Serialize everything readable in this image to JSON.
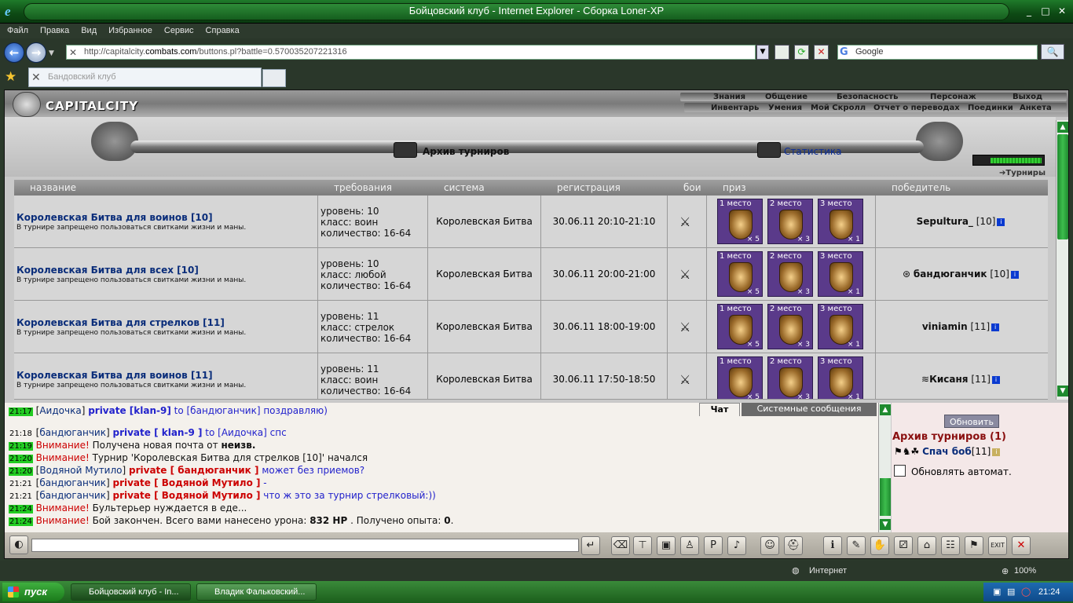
{
  "window": {
    "title": "Бойцовский клуб - Internet Explorer - Сборка Loner-XP",
    "controls": [
      "_",
      "□",
      "✕"
    ]
  },
  "menu": [
    "Файл",
    "Правка",
    "Вид",
    "Избранное",
    "Сервис",
    "Справка"
  ],
  "address": {
    "prefix": "http://capitalcity.",
    "domain": "combats.com",
    "suffix": "/buttons.pl?battle=0.570035207221316"
  },
  "search": {
    "placeholder": "Google"
  },
  "tab": {
    "label": "Бандовский клуб"
  },
  "site": {
    "logo": "CAPITALCITY",
    "nav_top": [
      "Знания",
      "Общение",
      "Безопасность",
      "Персонаж",
      "Выход"
    ],
    "nav_bottom": [
      "Инвентарь",
      "Умения",
      "Мой Скролл",
      "Отчет о переводах",
      "Поединки",
      "Анкета"
    ]
  },
  "banner": {
    "archive": "Архив турниров",
    "stats": "Статистика",
    "tournaments_link": "Турниры"
  },
  "table": {
    "headers": [
      "название",
      "требования",
      "система",
      "регистрация",
      "бои",
      "приз",
      "победитель"
    ],
    "rows": [
      {
        "name": "Королевская Битва для воинов [10]",
        "desc": "В турнире запрещено пользоваться свитками жизни и маны.",
        "req": [
          "уровень: 10",
          "класс: воин",
          "количество: 16-64"
        ],
        "system": "Королевская Битва",
        "reg": "30.06.11 20:10-21:10",
        "prizes": [
          {
            "place": "1 место",
            "count": "× 5"
          },
          {
            "place": "2 место",
            "count": "× 3"
          },
          {
            "place": "3 место",
            "count": "× 1"
          }
        ],
        "winner": "Sepultura_",
        "winner_lvl": "[10]"
      },
      {
        "name": "Королевская Битва для всех [10]",
        "desc": "В турнире запрещено пользоваться свитками жизни и маны.",
        "req": [
          "уровень: 10",
          "класс: любой",
          "количество: 16-64"
        ],
        "system": "Королевская Битва",
        "reg": "30.06.11 20:00-21:00",
        "prizes": [
          {
            "place": "1 место",
            "count": "× 5"
          },
          {
            "place": "2 место",
            "count": "× 3"
          },
          {
            "place": "3 место",
            "count": "× 1"
          }
        ],
        "winner": "бандюганчик",
        "winner_lvl": "[10]"
      },
      {
        "name": "Королевская Битва для стрелков [11]",
        "desc": "В турнире запрещено пользоваться свитками жизни и маны.",
        "req": [
          "уровень: 11",
          "класс: стрелок",
          "количество: 16-64"
        ],
        "system": "Королевская Битва",
        "reg": "30.06.11 18:00-19:00",
        "prizes": [
          {
            "place": "1 место",
            "count": "× 5"
          },
          {
            "place": "2 место",
            "count": "× 3"
          },
          {
            "place": "3 место",
            "count": "× 1"
          }
        ],
        "winner": "viniamin",
        "winner_lvl": "[11]"
      },
      {
        "name": "Королевская Битва для воинов [11]",
        "desc": "В турнире запрещено пользоваться свитками жизни и маны.",
        "req": [
          "уровень: 11",
          "класс: воин",
          "количество: 16-64"
        ],
        "system": "Королевская Битва",
        "reg": "30.06.11 17:50-18:50",
        "prizes": [
          {
            "place": "1 место",
            "count": "× 5"
          },
          {
            "place": "2 место",
            "count": "× 3"
          },
          {
            "place": "3 место",
            "count": "× 1"
          }
        ],
        "winner": "Кисаня",
        "winner_lvl": "[11]"
      }
    ]
  },
  "chat": {
    "tabs": [
      "Чат",
      "Системные сообщения"
    ],
    "lines": [
      {
        "time": "21:17",
        "parts": [
          [
            "",
            "["
          ],
          [
            "nick",
            "Аидочка"
          ],
          [
            "",
            "] "
          ],
          [
            "priv",
            "private [klan-9]"
          ],
          [
            "tofrom",
            " to [бандюганчик] поздравляю)"
          ]
        ]
      },
      {
        "time": "21:18",
        "gray": true,
        "parts": [
          [
            "",
            "["
          ],
          [
            "nick",
            "бандюганчик"
          ],
          [
            "",
            "] "
          ],
          [
            "priv",
            "private [ klan-9 ]"
          ],
          [
            "tofrom",
            " to [Аидочка] спс"
          ]
        ]
      },
      {
        "time": "21:19",
        "parts": [
          [
            "warn",
            "Внимание!"
          ],
          [
            "",
            " Получена новая почта от "
          ],
          [
            "b",
            "неизв."
          ]
        ]
      },
      {
        "time": "21:20",
        "parts": [
          [
            "warn",
            "Внимание!"
          ],
          [
            "",
            " Турнир 'Королевская Битва для стрелков [10]' начался"
          ]
        ]
      },
      {
        "time": "21:20",
        "parts": [
          [
            "",
            "["
          ],
          [
            "nick",
            "Водяной Мутило"
          ],
          [
            "",
            "] "
          ],
          [
            "privr",
            "private [ бандюганчик ]"
          ],
          [
            "tofrom",
            " может без приемов?"
          ]
        ]
      },
      {
        "time": "21:21",
        "gray": true,
        "parts": [
          [
            "",
            "["
          ],
          [
            "nick",
            "бандюганчик"
          ],
          [
            "",
            "] "
          ],
          [
            "privr",
            "private [ Водяной Мутило ]"
          ],
          [
            "tofrom",
            " -"
          ]
        ]
      },
      {
        "time": "21:21",
        "gray": true,
        "parts": [
          [
            "",
            "["
          ],
          [
            "nick",
            "бандюганчик"
          ],
          [
            "",
            "] "
          ],
          [
            "privr",
            "private [ Водяной Мутило ]"
          ],
          [
            "tofrom",
            " что ж это за турнир стрелковый:))"
          ]
        ]
      },
      {
        "time": "21:24",
        "parts": [
          [
            "warn",
            "Внимание!"
          ],
          [
            "",
            " Бультерьер нуждается в еде..."
          ]
        ]
      },
      {
        "time": "21:24",
        "parts": [
          [
            "warn",
            "Внимание!"
          ],
          [
            "",
            " Бой закончен. Всего вами нанесено урона: "
          ],
          [
            "b",
            "832 HP"
          ],
          [
            "",
            " . Получено опыта: "
          ],
          [
            "b",
            "0"
          ],
          [
            "",
            "."
          ]
        ]
      }
    ]
  },
  "side": {
    "refresh": "Обновить",
    "archive": "Архив турниров (1)",
    "player": "Спач боб",
    "player_lvl": "[11]",
    "auto": "Обновлять автомат."
  },
  "status": {
    "zone": "Интернет",
    "zoom": "100%"
  },
  "taskbar": {
    "start": "пуск",
    "tasks": [
      "Бойцовский клуб - In...",
      "Владик Фальковский..."
    ],
    "time": "21:24"
  }
}
